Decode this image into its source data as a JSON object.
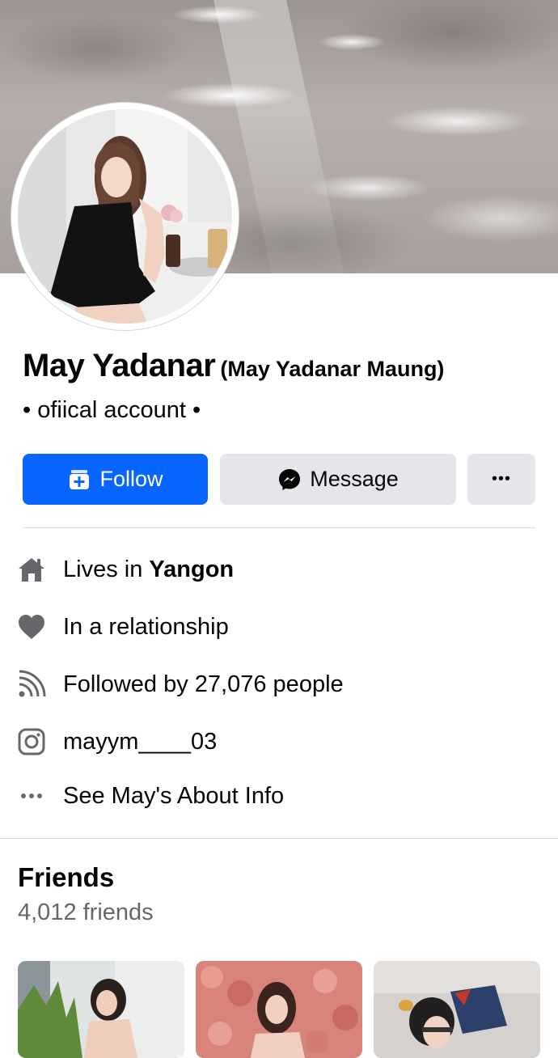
{
  "profile": {
    "name": "May Yadanar",
    "alternate_name": "(May Yadanar Maung)",
    "bio": "• ofiical account •"
  },
  "actions": {
    "follow_label": "Follow",
    "message_label": "Message",
    "more_label": "•••"
  },
  "intro": {
    "lives_in_prefix": "Lives in ",
    "lives_in_city": "Yangon",
    "relationship": "In a relationship",
    "followers": "Followed by 27,076 people",
    "instagram": "mayym____03",
    "about_link": "See May's About Info"
  },
  "friends": {
    "title": "Friends",
    "count": "4,012 friends"
  },
  "icons": {
    "follow": "follow-plus-icon",
    "message": "messenger-icon",
    "home": "home-icon",
    "relationship": "heart-icon",
    "followers": "rss-feed-icon",
    "instagram": "instagram-icon",
    "more": "more-dots-icon"
  },
  "colors": {
    "primary": "#0866ff",
    "secondary_button": "#e4e6eb",
    "muted_text": "#65676b",
    "icon_gray": "#65676b"
  }
}
